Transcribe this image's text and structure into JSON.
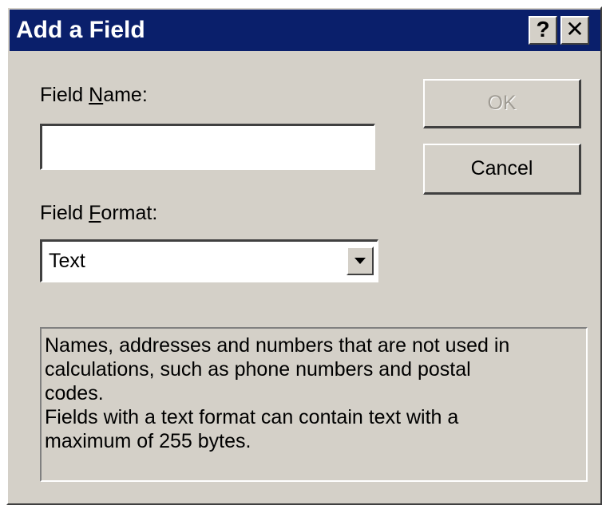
{
  "window": {
    "title": "Add a Field",
    "help_label": "?",
    "close_label": "✕"
  },
  "field_name": {
    "label_before": "Field ",
    "label_mnemonic": "N",
    "label_after": "ame:",
    "value": ""
  },
  "field_format": {
    "label_before": "Field ",
    "label_mnemonic": "F",
    "label_after": "ormat:",
    "selected": "Text"
  },
  "buttons": {
    "ok_label": "OK",
    "ok_enabled": false,
    "cancel_label": "Cancel"
  },
  "description": {
    "lines": [
      "Names, addresses and numbers that are not used in",
      "calculations, such as phone numbers and postal",
      "codes.",
      "Fields with a text format can contain text with a",
      "maximum of 255 bytes."
    ]
  },
  "colors": {
    "titlebar": "#0a1f6b",
    "face": "#d4d0c8"
  }
}
